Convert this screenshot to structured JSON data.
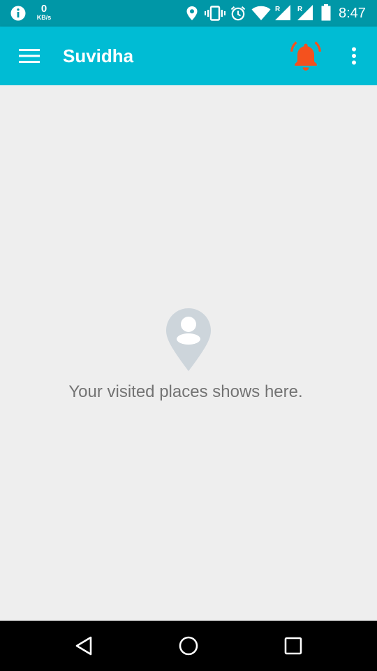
{
  "status_bar": {
    "speed_value": "0",
    "speed_unit": "KB/s",
    "time": "8:47",
    "icons": [
      "info-icon",
      "location-icon",
      "vibrate-icon",
      "alarm-icon",
      "wifi-icon",
      "signal-icon",
      "signal-icon",
      "battery-icon"
    ]
  },
  "app_bar": {
    "title": "Suvidha",
    "menu_icon": "hamburger-menu-icon",
    "alert_icon": "ringing-bell-icon",
    "overflow_icon": "more-vert-icon",
    "alert_color": "#f4511e",
    "bar_color": "#00bcd4",
    "status_color": "#0097a7"
  },
  "main": {
    "empty_icon": "person-pin-icon",
    "empty_message": "Your visited places shows here."
  },
  "nav_bar": {
    "buttons": [
      "back-icon",
      "home-icon",
      "recents-icon"
    ]
  }
}
